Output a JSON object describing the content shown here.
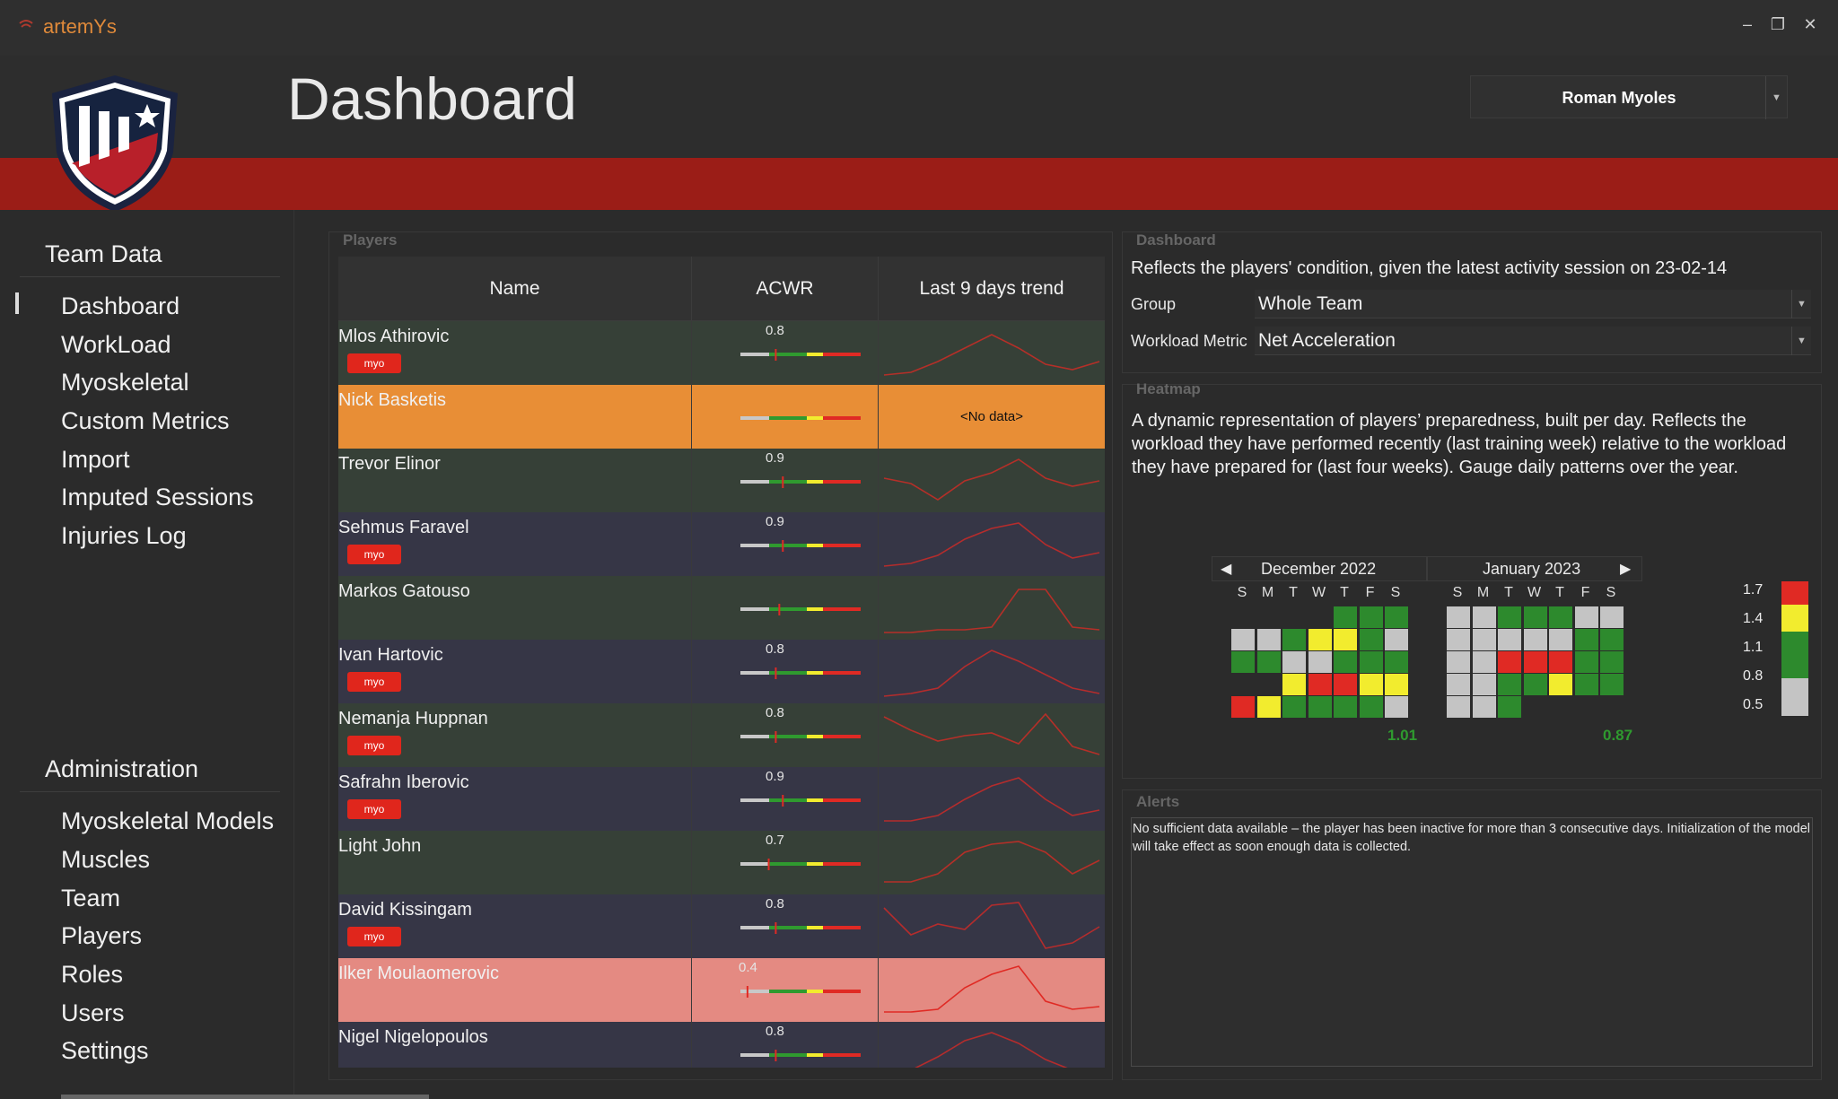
{
  "app": {
    "name": "artemYs"
  },
  "header": {
    "title": "Dashboard",
    "user": "Roman Myoles"
  },
  "sidebar": {
    "team_section": "Team Data",
    "team_items": [
      "Dashboard",
      "WorkLoad",
      "Myoskeletal",
      "Custom Metrics",
      "Import",
      "Imputed Sessions",
      "Injuries Log"
    ],
    "admin_section": "Administration",
    "admin_items": [
      "Myoskeletal Models",
      "Muscles",
      "Team",
      "Players",
      "Roles",
      "Users",
      "Settings"
    ],
    "active": "Dashboard"
  },
  "players": {
    "panel_title": "Players",
    "columns": [
      "Name",
      "ACWR",
      "Last 9 days trend"
    ],
    "badge_label": "myo",
    "no_data_label": "<No data>",
    "rows": [
      {
        "name": "Mlos Athirovic",
        "acwr": "0.8",
        "acwr_value": 0.8,
        "myo": true,
        "status": "normal",
        "trend": [
          0.1,
          0.15,
          0.35,
          0.6,
          0.85,
          0.6,
          0.3,
          0.2,
          0.35
        ]
      },
      {
        "name": "Nick Basketis",
        "acwr": "",
        "acwr_value": null,
        "myo": false,
        "status": "orange",
        "trend": null
      },
      {
        "name": "Trevor Elinor",
        "acwr": "0.9",
        "acwr_value": 0.9,
        "myo": false,
        "status": "normal",
        "trend": [
          0.55,
          0.45,
          0.15,
          0.5,
          0.65,
          0.9,
          0.55,
          0.4,
          0.5
        ]
      },
      {
        "name": "Sehmus Faravel",
        "acwr": "0.9",
        "acwr_value": 0.9,
        "myo": true,
        "status": "normal",
        "trend": [
          0.1,
          0.15,
          0.3,
          0.6,
          0.8,
          0.9,
          0.5,
          0.25,
          0.35
        ]
      },
      {
        "name": "Markos Gatouso",
        "acwr": "",
        "acwr_value": 0.85,
        "myo": false,
        "status": "normal",
        "trend": [
          0.05,
          0.05,
          0.1,
          0.1,
          0.15,
          0.85,
          0.85,
          0.15,
          0.1
        ]
      },
      {
        "name": "Ivan Hartovic",
        "acwr": "0.8",
        "acwr_value": 0.8,
        "myo": true,
        "status": "normal",
        "trend": [
          0.05,
          0.1,
          0.2,
          0.6,
          0.9,
          0.7,
          0.45,
          0.2,
          0.1
        ]
      },
      {
        "name": "Nemanja Huppnan",
        "acwr": "0.8",
        "acwr_value": 0.8,
        "myo": true,
        "status": "normal",
        "trend": [
          0.85,
          0.6,
          0.4,
          0.5,
          0.55,
          0.35,
          0.9,
          0.3,
          0.15
        ]
      },
      {
        "name": "Safrahn Iberovic",
        "acwr": "0.9",
        "acwr_value": 0.9,
        "myo": true,
        "status": "normal",
        "trend": [
          0.1,
          0.1,
          0.2,
          0.5,
          0.75,
          0.9,
          0.5,
          0.2,
          0.3
        ]
      },
      {
        "name": "Light John",
        "acwr": "0.7",
        "acwr_value": 0.7,
        "myo": false,
        "status": "normal",
        "trend": [
          0.15,
          0.15,
          0.3,
          0.7,
          0.85,
          0.9,
          0.7,
          0.3,
          0.55
        ]
      },
      {
        "name": "David Kissingam",
        "acwr": "0.8",
        "acwr_value": 0.8,
        "myo": true,
        "status": "normal",
        "trend": [
          0.85,
          0.35,
          0.55,
          0.45,
          0.9,
          0.95,
          0.1,
          0.2,
          0.5
        ]
      },
      {
        "name": "Ilker Moulaomerovic",
        "acwr": "0.4",
        "acwr_value": 0.4,
        "myo": false,
        "status": "red",
        "trend": [
          0.1,
          0.1,
          0.15,
          0.55,
          0.8,
          0.95,
          0.3,
          0.15,
          0.2
        ]
      },
      {
        "name": "Nigel Nigelopoulos",
        "acwr": "0.8",
        "acwr_value": 0.8,
        "myo": false,
        "status": "normal",
        "trend": [
          0.1,
          0.2,
          0.45,
          0.75,
          0.9,
          0.7,
          0.4,
          0.2,
          0.1
        ]
      }
    ]
  },
  "dashboard": {
    "panel_title": "Dashboard",
    "description": "Reflects the players' condition, given the latest activity session on 23-02-14",
    "group_label": "Group",
    "group_value": "Whole Team",
    "metric_label": "Workload Metric",
    "metric_value": "Net Acceleration"
  },
  "heatmap": {
    "panel_title": "Heatmap",
    "description": "A dynamic representation of players’ preparedness, built per day. Reflects the workload they have performed recently (last training week) relative to the workload they have prepared for (last four weeks). Gauge daily patterns over the year.",
    "weekdays": [
      "S",
      "M",
      "T",
      "W",
      "T",
      "F",
      "S"
    ],
    "colors": {
      "g": "#2d8a2d",
      "y": "#f2ec2e",
      "r": "#e02a24",
      "s": "#c4c4c4"
    },
    "months": [
      {
        "label": "December 2022",
        "score": "1.01",
        "grid": [
          [
            "",
            "",
            "",
            "",
            "g",
            "g",
            "g"
          ],
          [
            "s",
            "s",
            "g",
            "y",
            "y",
            "g",
            "s"
          ],
          [
            "g",
            "g",
            "s",
            "s",
            "g",
            "g",
            "g"
          ],
          [
            "",
            "",
            "y",
            "r",
            "r",
            "y",
            "y"
          ],
          [
            "r",
            "y",
            "g",
            "g",
            "g",
            "g",
            "s"
          ]
        ]
      },
      {
        "label": "January 2023",
        "score": "0.87",
        "grid": [
          [
            "s",
            "s",
            "g",
            "g",
            "g",
            "s",
            "s"
          ],
          [
            "s",
            "s",
            "s",
            "s",
            "s",
            "g",
            "g"
          ],
          [
            "s",
            "s",
            "r",
            "r",
            "r",
            "g",
            "g"
          ],
          [
            "s",
            "s",
            "g",
            "g",
            "y",
            "g",
            "g"
          ],
          [
            "s",
            "s",
            "g",
            "",
            "",
            "",
            ""
          ]
        ]
      }
    ],
    "legend": [
      "1.7",
      "1.4",
      "1.1",
      "0.8",
      "0.5"
    ]
  },
  "alerts": {
    "panel_title": "Alerts",
    "text": "No sufficient data available – the player has been inactive for more than 3 consecutive days. Initialization of the model will take effect as soon enough data is collected."
  }
}
